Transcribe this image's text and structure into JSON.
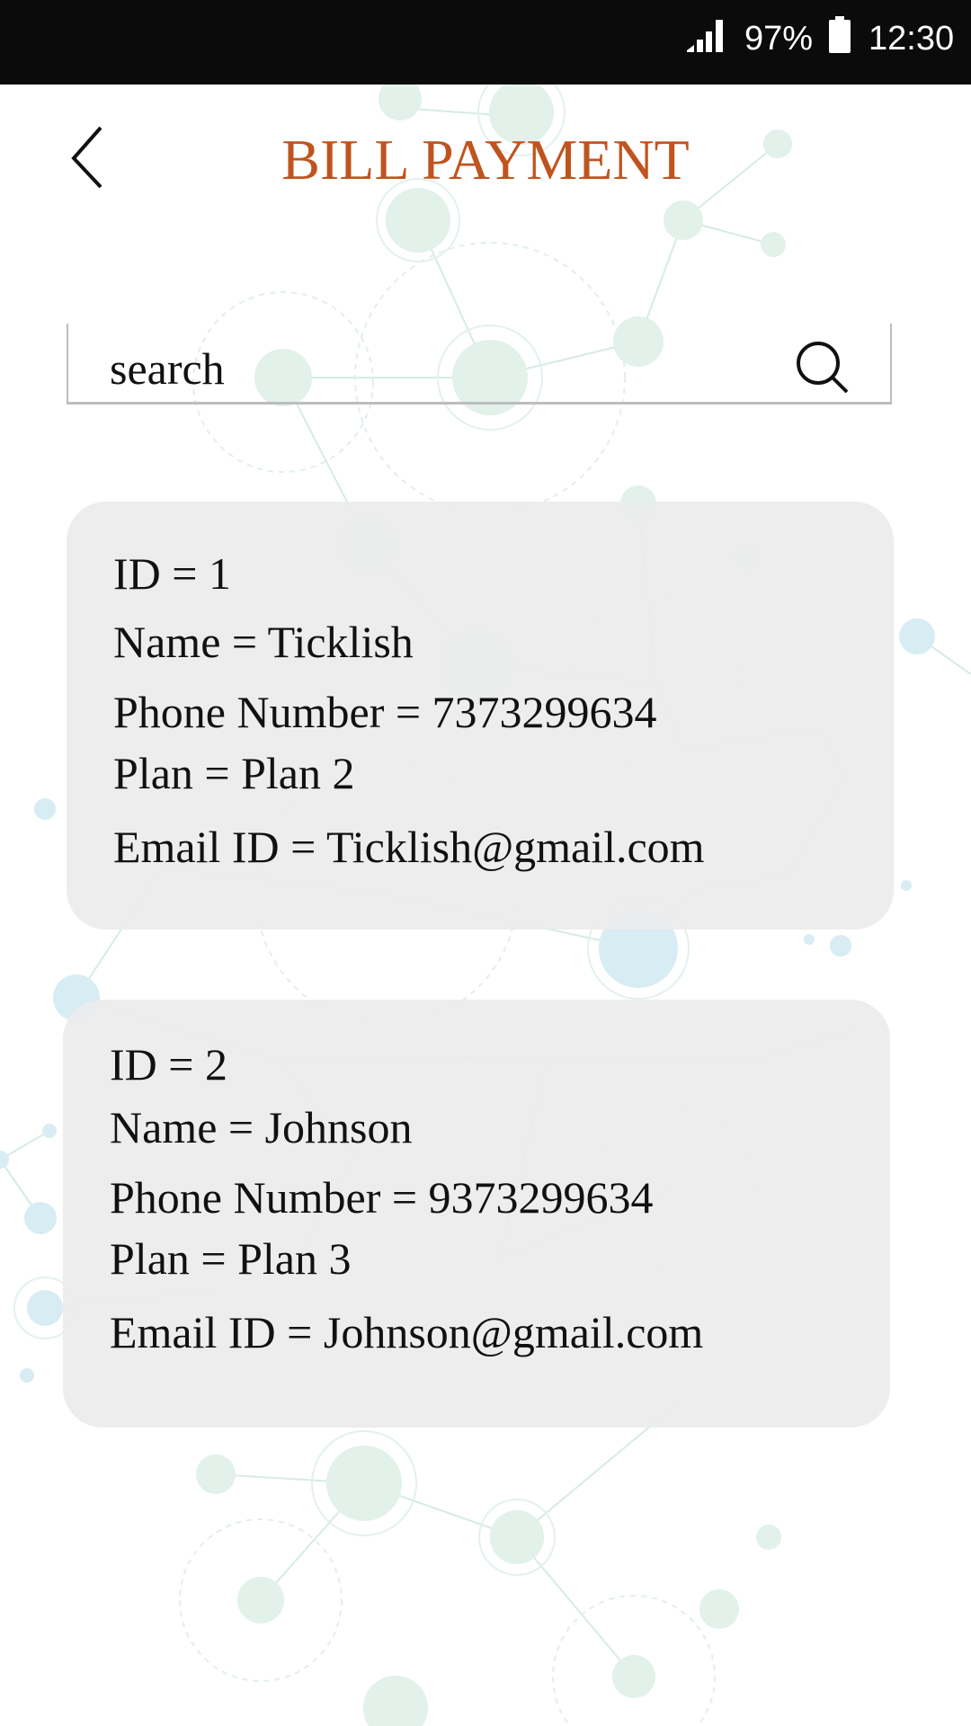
{
  "status_bar": {
    "battery_percent": "97%",
    "time": "12:30",
    "signal_icon": "signal-icon",
    "battery_icon": "battery-icon"
  },
  "header": {
    "title": "BILL PAYMENT",
    "back_icon": "chevron-left-icon"
  },
  "search": {
    "placeholder": "search",
    "icon": "search-icon"
  },
  "colors": {
    "title": "#c0541e",
    "status_bar": "#0b0b0b",
    "card": "#ececec"
  },
  "customers": [
    {
      "id": "ID = 1",
      "name": "Name = Ticklish",
      "phone": "Phone Number = 7373299634",
      "plan": "Plan = Plan 2",
      "email": "Email ID = Ticklish@gmail.com"
    },
    {
      "id": "ID = 2",
      "name": "Name = Johnson",
      "phone": "Phone Number = 9373299634",
      "plan": "Plan = Plan 3",
      "email": "Email ID = Johnson@gmail.com"
    }
  ]
}
